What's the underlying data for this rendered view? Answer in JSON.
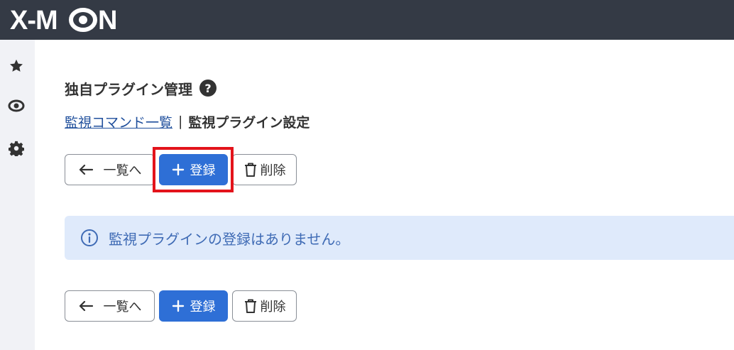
{
  "header": {
    "logo_text": "X-MON",
    "colors": {
      "bar": "#343a45",
      "logo": "#ffffff"
    }
  },
  "sidebar": {
    "items": [
      {
        "icon": "star-icon",
        "name": "favorites"
      },
      {
        "icon": "eye-icon",
        "name": "monitoring"
      },
      {
        "icon": "gear-icon",
        "name": "settings"
      }
    ]
  },
  "main": {
    "title": "独自プラグイン管理",
    "help_symbol": "?",
    "breadcrumb": {
      "link": "監視コマンド一覧",
      "separator": "|",
      "current": "監視プラグイン設定"
    },
    "actions": {
      "back_label": "一覧へ",
      "register_label": "登録",
      "delete_label": "削除"
    },
    "alert": {
      "icon": "info-icon",
      "message": "監視プラグインの登録はありません。"
    }
  },
  "colors": {
    "primary": "#2e6fd6",
    "highlight": "#e3131b",
    "alert_bg": "#dfeafb",
    "alert_text": "#3f6bb5",
    "link": "#1f4f9c"
  }
}
